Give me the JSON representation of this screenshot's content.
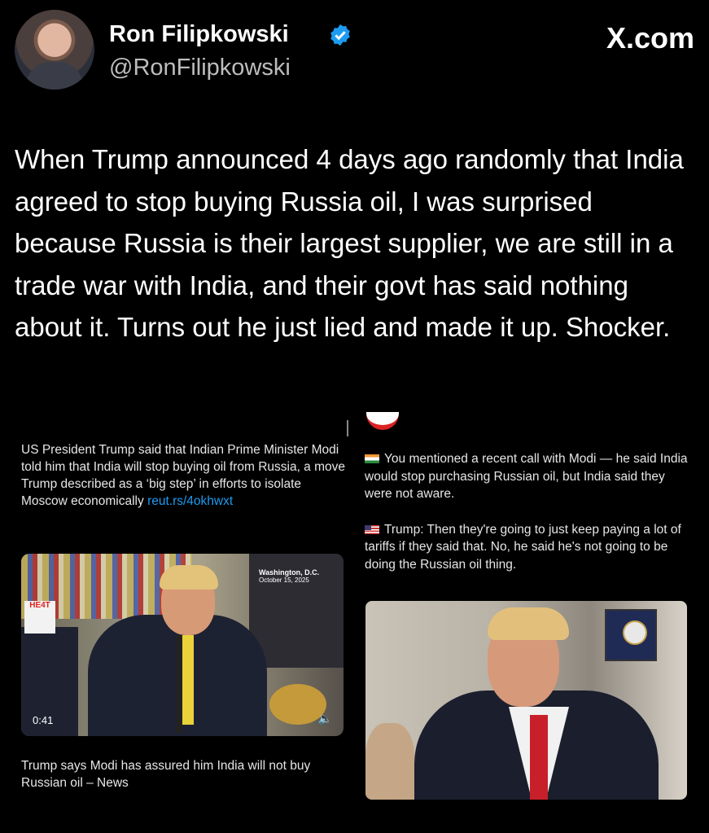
{
  "header": {
    "name": "Ron Filipkowski",
    "handle": "@RonFilipkowski",
    "site": "X.com"
  },
  "tweet": {
    "text": "When Trump announced 4 days ago randomly that India agreed to stop buying Russia oil, I was surprised because Russia is their largest supplier, we are still in a trade war with India, and their govt has said nothing about it. Turns out he just lied and made it up. Shocker."
  },
  "left_card": {
    "text": "US President Trump said that Indian Prime Minister Modi told him that India will stop buying oil from Russia, a move Trump described as a ‘big step’ in efforts to isolate Moscow economically ",
    "link": "reut.rs/4okhwxt",
    "video": {
      "place": "Washington, D.C.",
      "date": "October 15, 2025",
      "badge": "HE4T",
      "duration": "0:41"
    },
    "caption": "Trump says Modi has assured him India will not buy Russian oil – News"
  },
  "right_card": {
    "question": "You mentioned a recent call with Modi — he said India would stop purchasing Russian oil, but India said they were not aware.",
    "answer": "Trump: Then they're going to just keep paying a lot of tariffs if they said that. No, he said he's not going to be doing the Russian oil thing."
  },
  "colors": {
    "background": "#000000",
    "link": "#1d9bf0",
    "verified": "#1d9bf0"
  }
}
